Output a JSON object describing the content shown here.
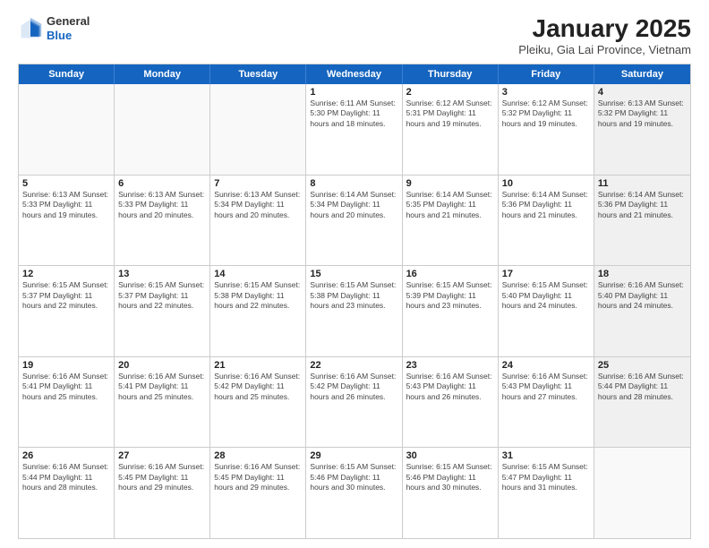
{
  "logo": {
    "general": "General",
    "blue": "Blue"
  },
  "title": "January 2025",
  "subtitle": "Pleiku, Gia Lai Province, Vietnam",
  "weekdays": [
    "Sunday",
    "Monday",
    "Tuesday",
    "Wednesday",
    "Thursday",
    "Friday",
    "Saturday"
  ],
  "rows": [
    [
      {
        "day": "",
        "info": "",
        "empty": true
      },
      {
        "day": "",
        "info": "",
        "empty": true
      },
      {
        "day": "",
        "info": "",
        "empty": true
      },
      {
        "day": "1",
        "info": "Sunrise: 6:11 AM\nSunset: 5:30 PM\nDaylight: 11 hours\nand 18 minutes."
      },
      {
        "day": "2",
        "info": "Sunrise: 6:12 AM\nSunset: 5:31 PM\nDaylight: 11 hours\nand 19 minutes."
      },
      {
        "day": "3",
        "info": "Sunrise: 6:12 AM\nSunset: 5:32 PM\nDaylight: 11 hours\nand 19 minutes."
      },
      {
        "day": "4",
        "info": "Sunrise: 6:13 AM\nSunset: 5:32 PM\nDaylight: 11 hours\nand 19 minutes.",
        "shaded": true
      }
    ],
    [
      {
        "day": "5",
        "info": "Sunrise: 6:13 AM\nSunset: 5:33 PM\nDaylight: 11 hours\nand 19 minutes."
      },
      {
        "day": "6",
        "info": "Sunrise: 6:13 AM\nSunset: 5:33 PM\nDaylight: 11 hours\nand 20 minutes."
      },
      {
        "day": "7",
        "info": "Sunrise: 6:13 AM\nSunset: 5:34 PM\nDaylight: 11 hours\nand 20 minutes."
      },
      {
        "day": "8",
        "info": "Sunrise: 6:14 AM\nSunset: 5:34 PM\nDaylight: 11 hours\nand 20 minutes."
      },
      {
        "day": "9",
        "info": "Sunrise: 6:14 AM\nSunset: 5:35 PM\nDaylight: 11 hours\nand 21 minutes."
      },
      {
        "day": "10",
        "info": "Sunrise: 6:14 AM\nSunset: 5:36 PM\nDaylight: 11 hours\nand 21 minutes."
      },
      {
        "day": "11",
        "info": "Sunrise: 6:14 AM\nSunset: 5:36 PM\nDaylight: 11 hours\nand 21 minutes.",
        "shaded": true
      }
    ],
    [
      {
        "day": "12",
        "info": "Sunrise: 6:15 AM\nSunset: 5:37 PM\nDaylight: 11 hours\nand 22 minutes."
      },
      {
        "day": "13",
        "info": "Sunrise: 6:15 AM\nSunset: 5:37 PM\nDaylight: 11 hours\nand 22 minutes."
      },
      {
        "day": "14",
        "info": "Sunrise: 6:15 AM\nSunset: 5:38 PM\nDaylight: 11 hours\nand 22 minutes."
      },
      {
        "day": "15",
        "info": "Sunrise: 6:15 AM\nSunset: 5:38 PM\nDaylight: 11 hours\nand 23 minutes."
      },
      {
        "day": "16",
        "info": "Sunrise: 6:15 AM\nSunset: 5:39 PM\nDaylight: 11 hours\nand 23 minutes."
      },
      {
        "day": "17",
        "info": "Sunrise: 6:15 AM\nSunset: 5:40 PM\nDaylight: 11 hours\nand 24 minutes."
      },
      {
        "day": "18",
        "info": "Sunrise: 6:16 AM\nSunset: 5:40 PM\nDaylight: 11 hours\nand 24 minutes.",
        "shaded": true
      }
    ],
    [
      {
        "day": "19",
        "info": "Sunrise: 6:16 AM\nSunset: 5:41 PM\nDaylight: 11 hours\nand 25 minutes."
      },
      {
        "day": "20",
        "info": "Sunrise: 6:16 AM\nSunset: 5:41 PM\nDaylight: 11 hours\nand 25 minutes."
      },
      {
        "day": "21",
        "info": "Sunrise: 6:16 AM\nSunset: 5:42 PM\nDaylight: 11 hours\nand 25 minutes."
      },
      {
        "day": "22",
        "info": "Sunrise: 6:16 AM\nSunset: 5:42 PM\nDaylight: 11 hours\nand 26 minutes."
      },
      {
        "day": "23",
        "info": "Sunrise: 6:16 AM\nSunset: 5:43 PM\nDaylight: 11 hours\nand 26 minutes."
      },
      {
        "day": "24",
        "info": "Sunrise: 6:16 AM\nSunset: 5:43 PM\nDaylight: 11 hours\nand 27 minutes."
      },
      {
        "day": "25",
        "info": "Sunrise: 6:16 AM\nSunset: 5:44 PM\nDaylight: 11 hours\nand 28 minutes.",
        "shaded": true
      }
    ],
    [
      {
        "day": "26",
        "info": "Sunrise: 6:16 AM\nSunset: 5:44 PM\nDaylight: 11 hours\nand 28 minutes."
      },
      {
        "day": "27",
        "info": "Sunrise: 6:16 AM\nSunset: 5:45 PM\nDaylight: 11 hours\nand 29 minutes."
      },
      {
        "day": "28",
        "info": "Sunrise: 6:16 AM\nSunset: 5:45 PM\nDaylight: 11 hours\nand 29 minutes."
      },
      {
        "day": "29",
        "info": "Sunrise: 6:15 AM\nSunset: 5:46 PM\nDaylight: 11 hours\nand 30 minutes."
      },
      {
        "day": "30",
        "info": "Sunrise: 6:15 AM\nSunset: 5:46 PM\nDaylight: 11 hours\nand 30 minutes."
      },
      {
        "day": "31",
        "info": "Sunrise: 6:15 AM\nSunset: 5:47 PM\nDaylight: 11 hours\nand 31 minutes."
      },
      {
        "day": "",
        "info": "",
        "empty": true,
        "shaded": true
      }
    ]
  ]
}
